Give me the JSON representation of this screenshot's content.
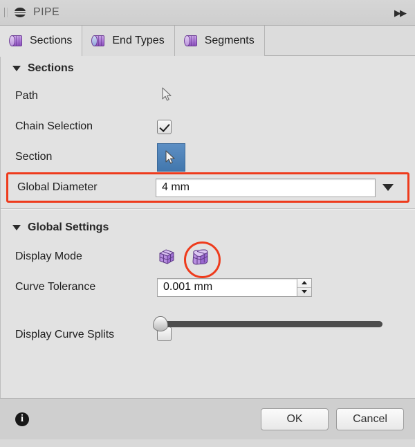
{
  "window": {
    "title": "PIPE",
    "pipe_icon": "pipe-icon",
    "expand_icon": "double-right-arrow-icon"
  },
  "tabs": [
    {
      "label": "Sections",
      "icon": "cylinder-icon",
      "active": true
    },
    {
      "label": "End Types",
      "icon": "cylinder-icon",
      "active": false
    },
    {
      "label": "Segments",
      "icon": "cylinder-icon",
      "active": false
    }
  ],
  "sections_group": {
    "title": "Sections",
    "rows": {
      "path": {
        "label": "Path"
      },
      "chain_selection": {
        "label": "Chain Selection",
        "checked": true
      },
      "section": {
        "label": "Section",
        "button_icon": "cursor-pick-icon"
      },
      "global_diameter": {
        "label": "Global Diameter",
        "value": "4 mm",
        "dropdown_icon": "chevron-down-icon",
        "highlighted": true
      }
    }
  },
  "global_settings_group": {
    "title": "Global Settings",
    "rows": {
      "display_mode": {
        "label": "Display Mode",
        "options": [
          "box-cube-icon",
          "rounded-cube-icon"
        ],
        "selected_index": 1,
        "highlighted": true
      },
      "curve_tolerance": {
        "label": "Curve Tolerance",
        "value": "0.001 mm",
        "slider_position_percent": 0
      },
      "display_curve_splits": {
        "label": "Display Curve Splits",
        "checked": false
      }
    }
  },
  "footer": {
    "info_icon": "info-icon",
    "info_glyph": "i",
    "ok_label": "OK",
    "cancel_label": "Cancel"
  },
  "colors": {
    "highlight": "#ee3b1c",
    "accent_blue": "#4a7ebb",
    "icon_purple": "#a974d4",
    "panel_bg": "#e2e2e2"
  }
}
